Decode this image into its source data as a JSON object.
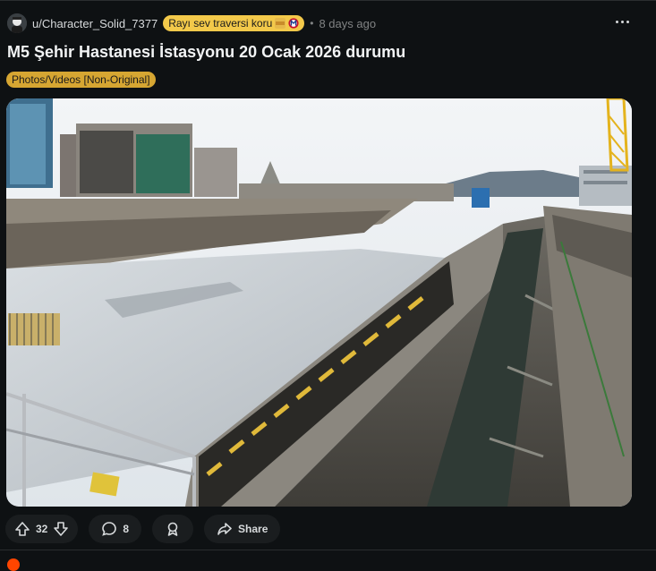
{
  "post": {
    "username": "u/Character_Solid_7377",
    "user_flair": "Rayı sev traversi koru",
    "separator": "•",
    "time": "8 days ago",
    "title": "M5 Şehir Hastanesi İstasyonu 20 Ocak 2026 durumu",
    "post_flair": "Photos/Videos [Non-Original]",
    "image_alt": "Construction site of a metro station with concrete walls, rebar and formwork"
  },
  "actions": {
    "vote_count": "32",
    "comment_count": "8",
    "share_label": "Share"
  },
  "colors": {
    "background": "#0e1113",
    "user_flair_bg": "#f3c94a",
    "post_flair_bg": "#d6a632",
    "pill_bg": "#1a1d1f"
  },
  "icons": [
    "upvote-icon",
    "downvote-icon",
    "comment-icon",
    "award-icon",
    "share-icon",
    "more-icon"
  ]
}
